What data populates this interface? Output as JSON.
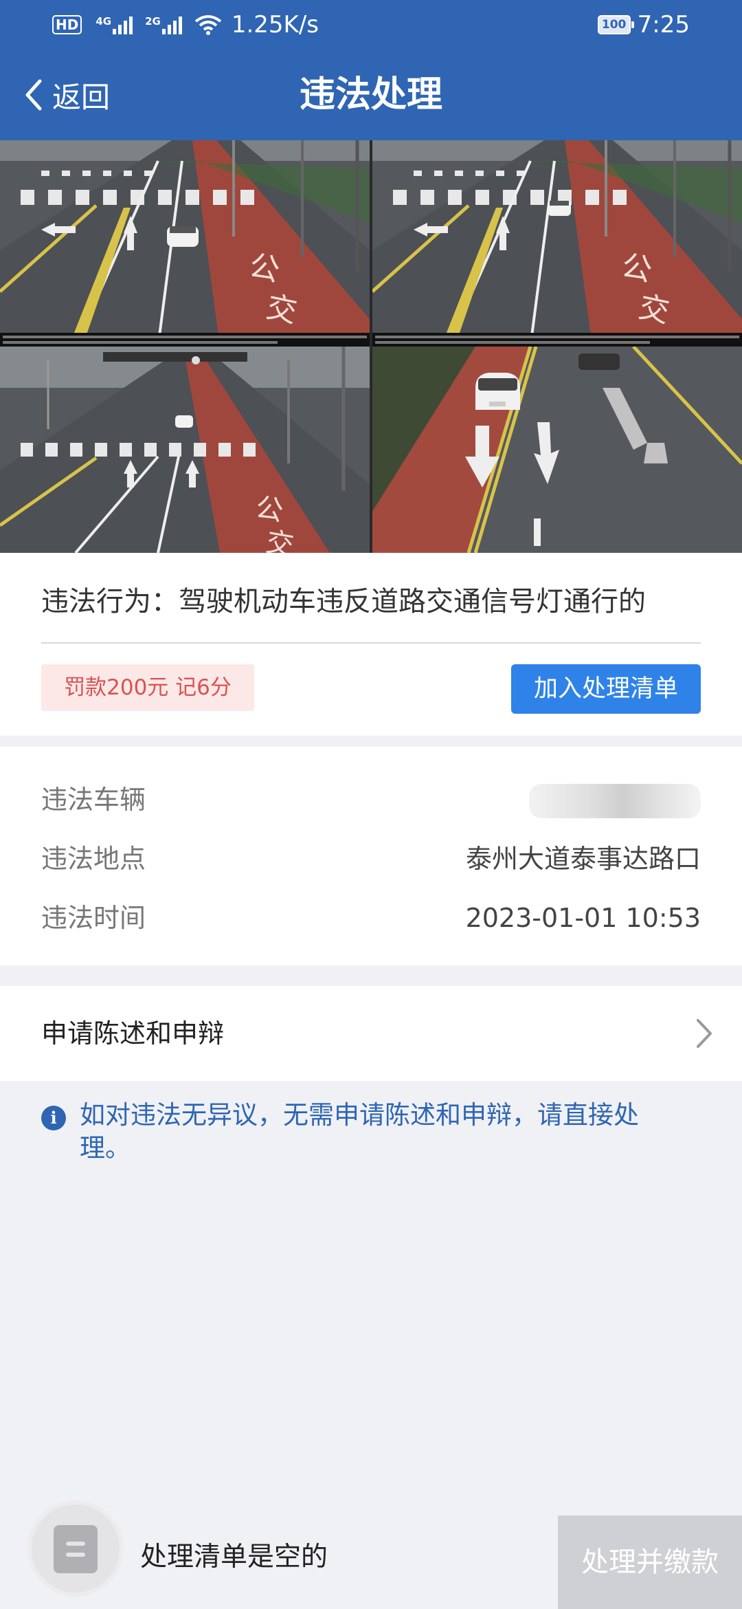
{
  "status_bar": {
    "hd_label": "HD",
    "network_1": "4G",
    "network_2": "2G",
    "speed": "1.25K/s",
    "battery": "100",
    "time": "7:25"
  },
  "header": {
    "back_label": "返回",
    "title": "违法处理"
  },
  "violation": {
    "behavior": "违法行为：驾驶机动车违反道路交通信号灯通行的",
    "penalty": "罚款200元 记6分",
    "add_button": "加入处理清单"
  },
  "details": {
    "vehicle_label": "违法车辆",
    "location_label": "违法地点",
    "location_value": "泰州大道泰事达路口",
    "time_label": "违法时间",
    "time_value": "2023-01-01 10:53"
  },
  "appeal": {
    "label": "申请陈述和申辩"
  },
  "notice": {
    "text": "如对违法无异议，无需申请陈述和申辩，请直接处理。"
  },
  "bottom_bar": {
    "empty_text": "处理清单是空的",
    "pay_button": "处理并缴款"
  },
  "colors": {
    "primary": "#2f65b3",
    "button": "#2f83e8",
    "penalty_text": "#d9534f",
    "penalty_bg": "#fde8e8",
    "disabled": "#cfd0d4"
  }
}
